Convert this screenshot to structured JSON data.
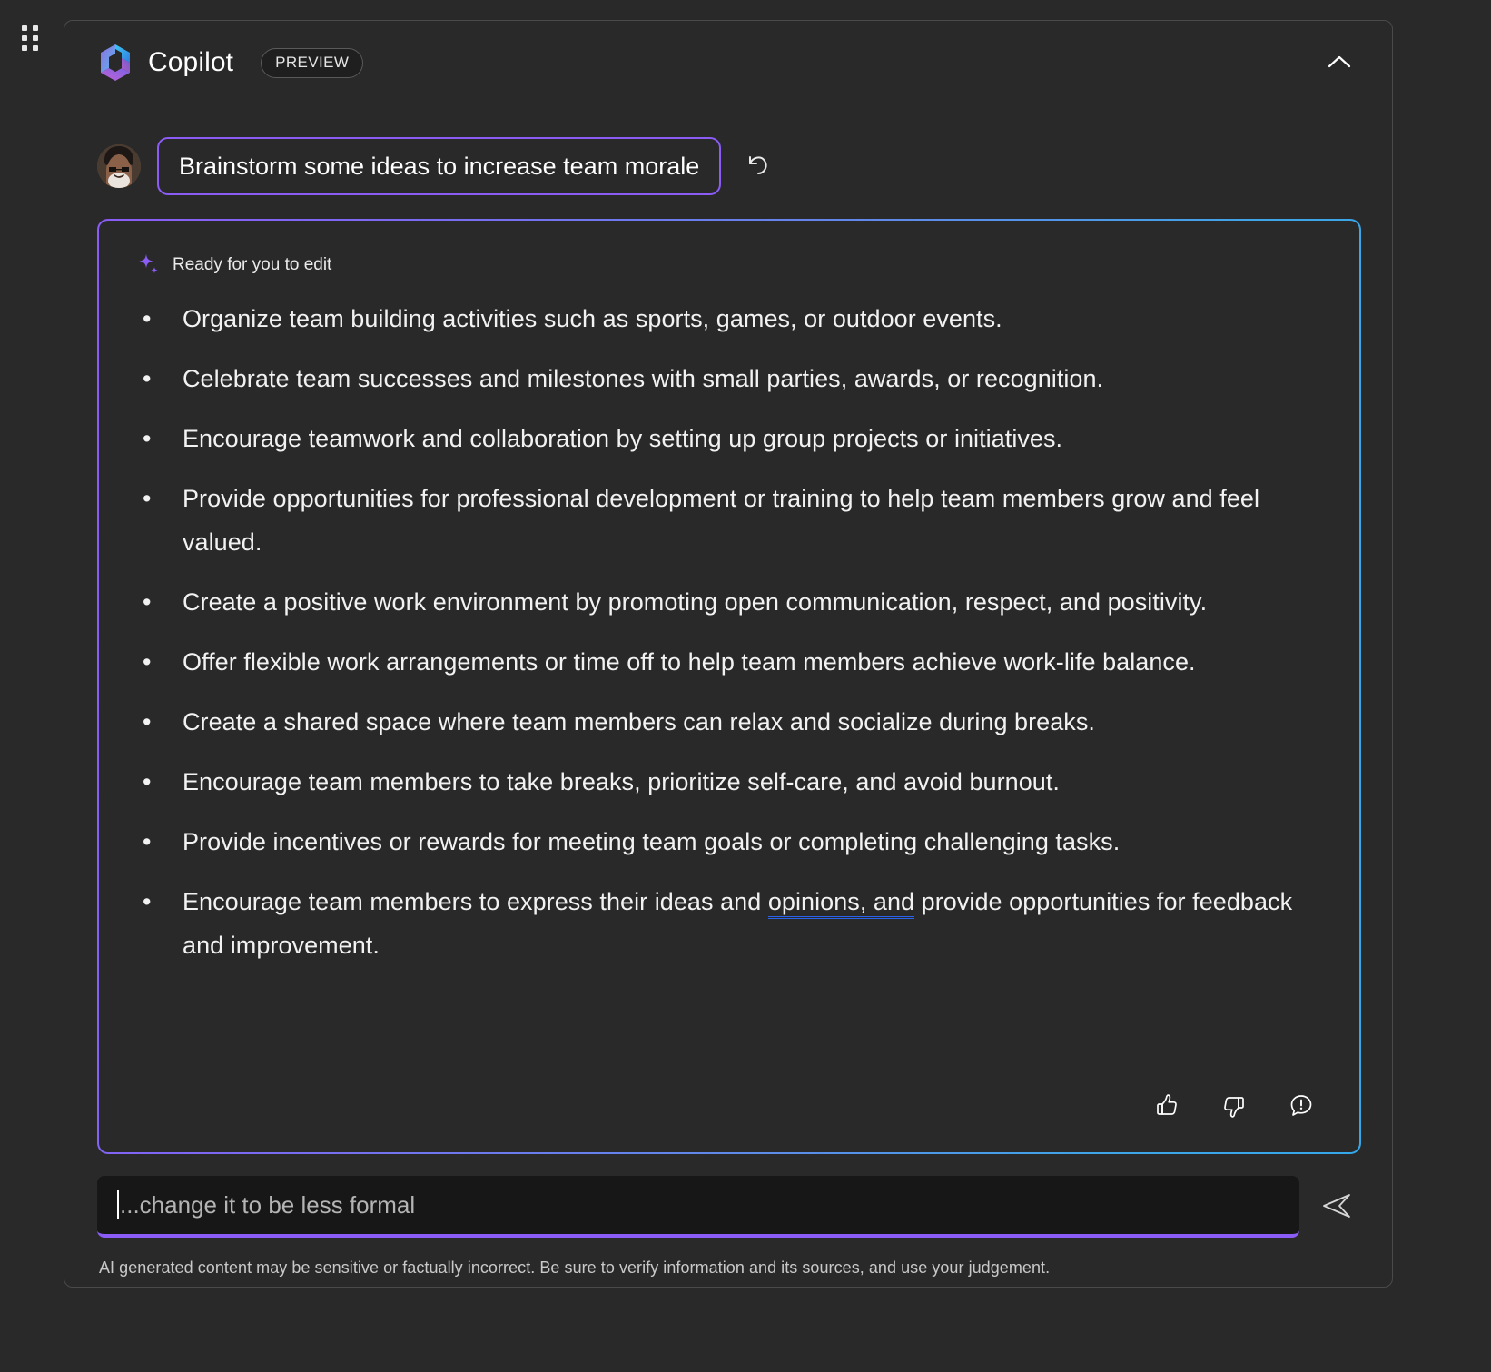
{
  "window": {
    "background_color": "#292929",
    "drag_handle_name": "drag-handle"
  },
  "header": {
    "logo_icon": "copilot-logo-icon",
    "title": "Copilot",
    "badge": "PREVIEW",
    "collapse_icon": "chevron-up-icon"
  },
  "prompt": {
    "avatar_name": "user-avatar",
    "text": "Brainstorm some ideas to increase team morale",
    "undo_icon": "undo-regenerate-icon"
  },
  "response": {
    "status_icon": "sparkle-icon",
    "status_label": "Ready for you to edit",
    "border_gradient_start": "#8b5cf6",
    "border_gradient_end": "#35a8ea",
    "ideas": [
      {
        "text": "Organize team building activities such as sports, games, or outdoor events."
      },
      {
        "text": "Celebrate team successes and milestones with small parties, awards, or recognition."
      },
      {
        "text": "Encourage teamwork and collaboration by setting up group projects or initiatives."
      },
      {
        "text": "Provide opportunities for professional development or training to help team members grow and feel valued."
      },
      {
        "text": "Create a positive work environment by promoting open communication, respect, and positivity."
      },
      {
        "text": "Offer flexible work arrangements or time off to help team members achieve work-life balance."
      },
      {
        "text": "Create a shared space where team members can relax and socialize during breaks."
      },
      {
        "text": "Encourage team members to take breaks, prioritize self-care, and avoid burnout."
      },
      {
        "text": "Provide incentives or rewards for meeting team goals or completing challenging tasks."
      },
      {
        "before": "Encourage team members to express their ideas and ",
        "flagged": "opinions, and",
        "after": " provide opportunities for feedback and improvement.",
        "flag_color": "#2b62ea"
      }
    ],
    "feedback": {
      "like_icon": "thumbs-up-icon",
      "dislike_icon": "thumbs-down-icon",
      "report_icon": "report-feedback-icon"
    }
  },
  "composer": {
    "placeholder": "...change it to be less formal",
    "value": "",
    "send_icon": "send-icon",
    "accent_color": "#8b5cf6"
  },
  "footer": {
    "disclaimer": "AI generated content may be sensitive or factually incorrect. Be sure to verify information and its sources, and use your judgement."
  }
}
